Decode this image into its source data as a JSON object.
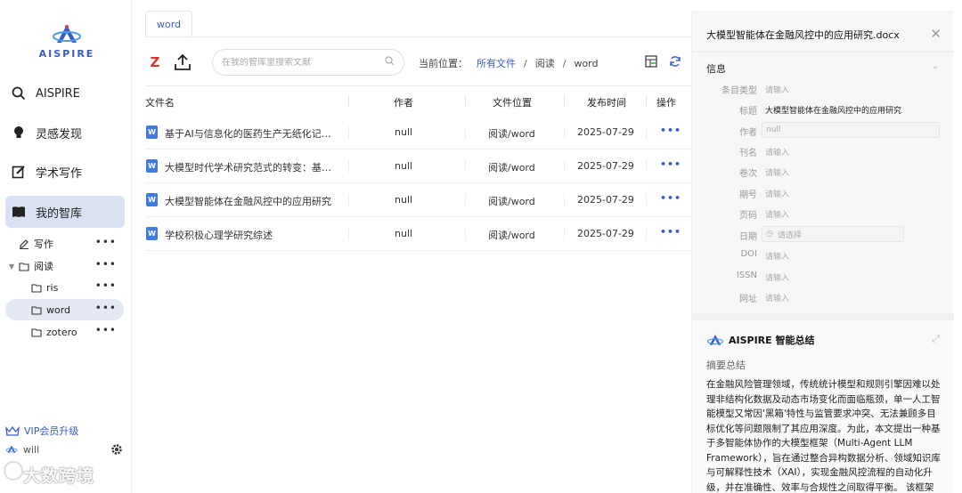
{
  "brand": {
    "logo_text": "AISPIRE",
    "accent": "#3b5cc6"
  },
  "sidebar": {
    "nav": [
      {
        "label": "AISPIRE",
        "icon": "search-icon"
      },
      {
        "label": "灵感发现",
        "icon": "bulb-icon"
      },
      {
        "label": "学术写作",
        "icon": "edit-icon"
      },
      {
        "label": "我的智库",
        "icon": "book-icon"
      }
    ],
    "tree": [
      {
        "label": "写作",
        "icon": "pen-icon",
        "more": "•••"
      },
      {
        "label": "阅读",
        "icon": "folder-icon",
        "more": "•••"
      },
      {
        "label": "ris",
        "icon": "folder-icon",
        "more": "•••"
      },
      {
        "label": "word",
        "icon": "folder-icon",
        "more": "•••"
      },
      {
        "label": "zotero",
        "icon": "folder-icon",
        "more": "•••"
      }
    ],
    "vip_label": "VIP会员升级",
    "username": "will"
  },
  "watermark": "大数跨境",
  "main": {
    "tab_label": "word",
    "search_placeholder": "在我的智库里搜索文献",
    "breadcrumb": {
      "prefix": "当前位置：",
      "items": [
        "所有文件",
        "阅读",
        "word"
      ],
      "sep": "/"
    },
    "columns": [
      "文件名",
      "作者",
      "文件位置",
      "发布时间",
      "操作"
    ],
    "rows": [
      {
        "name": "基于AI与信息化的医药生产无纸化记录系统研究",
        "author": "null",
        "location": "阅读/word",
        "date": "2025-07-29",
        "action": "•••"
      },
      {
        "name": "大模型时代学术研究范式的转变：基于智能体的研究",
        "author": "null",
        "location": "阅读/word",
        "date": "2025-07-29",
        "action": "•••"
      },
      {
        "name": "大模型智能体在金融风控中的应用研究",
        "author": "null",
        "location": "阅读/word",
        "date": "2025-07-29",
        "action": "•••"
      },
      {
        "name": "学校积极心理学研究综述",
        "author": "null",
        "location": "阅读/word",
        "date": "2025-07-29",
        "action": "•••"
      }
    ]
  },
  "panel": {
    "title": "大模型智能体在金融风控中的应用研究.docx",
    "info_header": "信息",
    "fields": [
      {
        "label": "条目类型",
        "value": "请输入"
      },
      {
        "label": "标题",
        "value": "大模型智能体在金融风控中的应用研究"
      },
      {
        "label": "作者",
        "value": "null"
      },
      {
        "label": "刊名",
        "value": "请输入"
      },
      {
        "label": "卷次",
        "value": "请输入"
      },
      {
        "label": "期号",
        "value": "请输入"
      },
      {
        "label": "页码",
        "value": "请输入"
      },
      {
        "label": "日期",
        "value": "请选择"
      },
      {
        "label": "DOI",
        "value": "请输入"
      },
      {
        "label": "ISSN",
        "value": "请输入"
      },
      {
        "label": "网址",
        "value": "请输入"
      }
    ],
    "ai_title": "AISPIRE 智能总结",
    "ai_subtitle": "摘要总结",
    "ai_text": "在金融风险管理领域，传统统计模型和规则引擎因难以处理非结构化数据及动态市场变化而面临瓶颈，单一人工智能模型又常因'黑箱'特性与监管要求冲突、无法兼顾多目标优化等问题限制了其应用深度。为此，本文提出一种基于多智能体协作的大模型框架（Multi-Agent LLM Framework），旨在通过整合异构数据分析、领域知识库与可解释性技术（XAI），实现金融风控流程的自动化升级，并在准确性、效率与合规性之间取得平衡。 该框架采用分层协作机制，由三个专门智能体构成，数据预处理智能体"
  }
}
